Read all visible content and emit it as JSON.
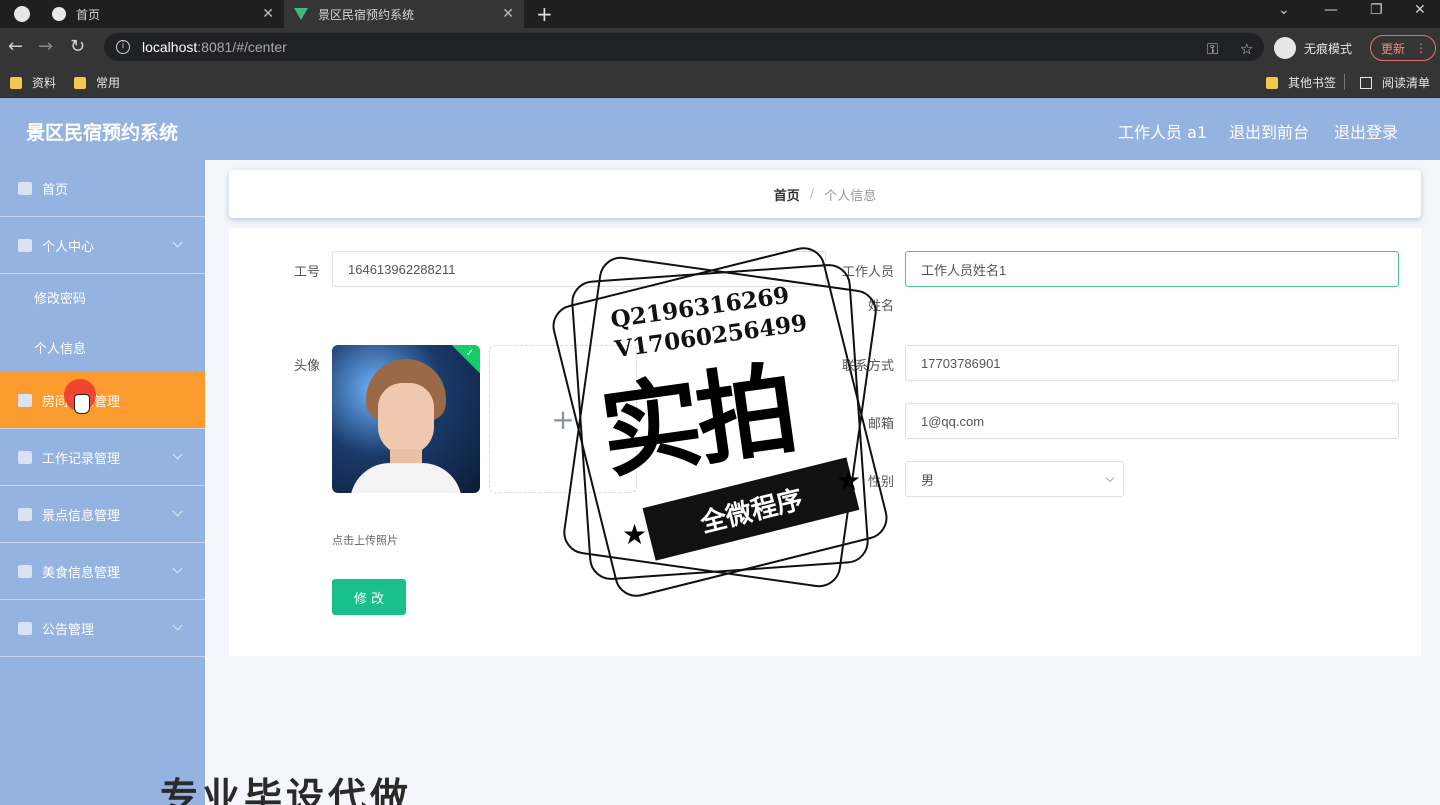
{
  "browser": {
    "tabs": [
      {
        "title": "首页"
      },
      {
        "title": "景区民宿预约系统"
      }
    ],
    "url_host": "localhost",
    "url_path": ":8081/#/center",
    "incognito_label": "无痕模式",
    "update_label": "更新",
    "bookmarks": [
      "资料",
      "常用"
    ],
    "bookmarks_right": [
      "其他书签",
      "阅读清单"
    ]
  },
  "header": {
    "title": "景区民宿预约系统",
    "user": "工作人员 a1",
    "to_front": "退出到前台",
    "logout": "退出登录"
  },
  "sidebar": {
    "items": [
      {
        "label": "首页"
      },
      {
        "label": "个人中心"
      },
      {
        "label": "修改密码"
      },
      {
        "label": "个人信息"
      },
      {
        "label": "房间信息管理"
      },
      {
        "label": "工作记录管理"
      },
      {
        "label": "景点信息管理"
      },
      {
        "label": "美食信息管理"
      },
      {
        "label": "公告管理"
      }
    ]
  },
  "breadcrumb": {
    "home": "首页",
    "sep": "/",
    "current": "个人信息"
  },
  "form": {
    "id_label": "工号",
    "id_value": "164613962288211",
    "name_label": "工作人员姓名",
    "name_value": "工作人员姓名1",
    "avatar_label": "头像",
    "upload_plus": "+",
    "upload_hint": "点击上传照片",
    "phone_label": "联系方式",
    "phone_value": "17703786901",
    "email_label": "邮箱",
    "email_value": "1@qq.com",
    "gender_label": "性别",
    "gender_value": "男",
    "submit_label": "修 改"
  },
  "watermark": {
    "q_line": "Q2196316269",
    "v_line": "V17060256499",
    "big": "实拍",
    "banner": "全微程序",
    "bottom": "专业毕设代做"
  },
  "colors": {
    "sidebar_bg": "#95b3e0",
    "active_menu": "#fd9c2e",
    "primary_button": "#19bf8a"
  }
}
